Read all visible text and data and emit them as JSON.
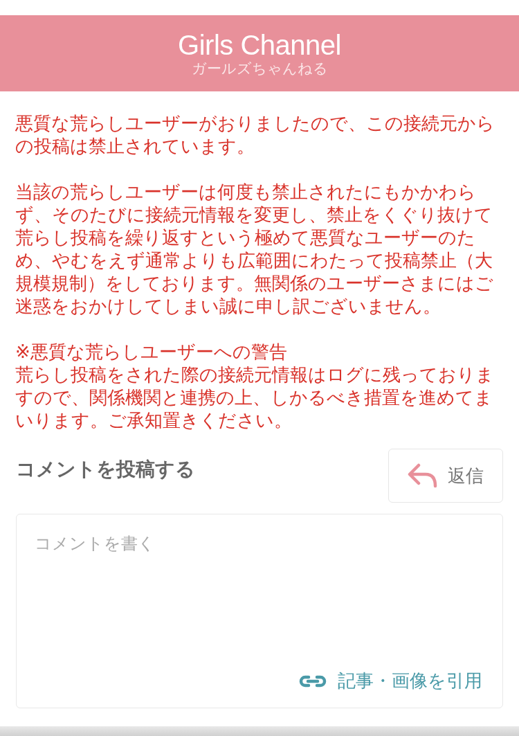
{
  "header": {
    "logo": "Girls Channel",
    "subtitle": "ガールズちゃんねる"
  },
  "notice": {
    "paragraphs": [
      "悪質な荒らしユーザーがおりましたので、この接続元からの投稿は禁止されています。",
      "当該の荒らしユーザーは何度も禁止されたにもかかわらず、そのたびに接続元情報を変更し、禁止をくぐり抜けて荒らし投稿を繰り返すという極めて悪質なユーザーのため、やむをえず通常よりも広範囲にわたって投稿禁止（大規模規制）をしております。無関係のユーザーさまにはご迷惑をおかけしてしまい誠に申し訳ございません。"
    ],
    "warning": {
      "title": "※悪質な荒らしユーザーへの警告",
      "body": "荒らし投稿をされた際の接続元情報はログに残っておりますので、関係機関と連携の上、しかるべき措置を進めてまいります。ご承知置きください。"
    }
  },
  "comment_form": {
    "title": "コメントを投稿する",
    "reply_button": "返信",
    "textarea": {
      "placeholder": "コメントを書く"
    },
    "quote_link": "記事・画像を引用"
  }
}
